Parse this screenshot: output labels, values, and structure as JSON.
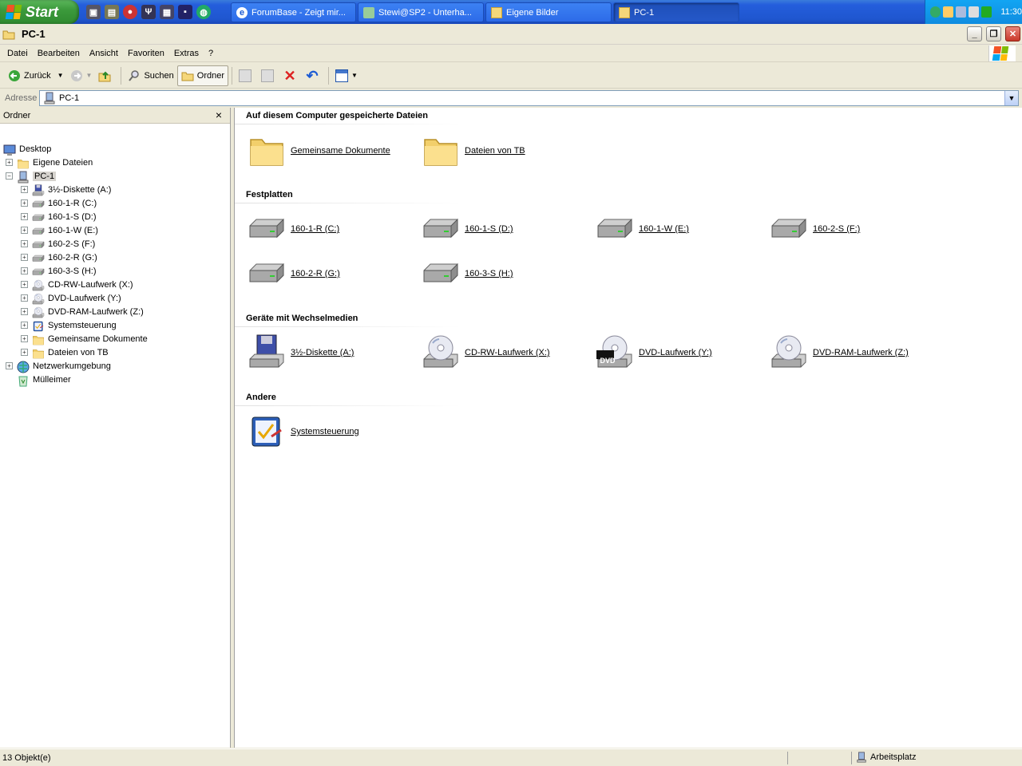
{
  "taskbar": {
    "start_label": "Start",
    "quicklaunch": [
      "app-icon",
      "app-icon",
      "app-icon",
      "app-icon",
      "app-icon",
      "save-icon",
      "globe-icon"
    ],
    "buttons": [
      {
        "label": "ForumBase - Zeigt mir..."
      },
      {
        "label": "Stewi@SP2 - Unterha..."
      },
      {
        "label": "Eigene Bilder"
      },
      {
        "label": "PC-1"
      }
    ],
    "clock": "11:30"
  },
  "window": {
    "title": "PC-1"
  },
  "menubar": {
    "items": [
      "Datei",
      "Bearbeiten",
      "Ansicht",
      "Favoriten",
      "Extras",
      "?"
    ]
  },
  "toolbar": {
    "back": "Zurück",
    "search": "Suchen",
    "folders": "Ordner"
  },
  "address": {
    "label": "Adresse",
    "value": "PC-1"
  },
  "folderpane": {
    "title": "Ordner",
    "close": "×",
    "tree": [
      {
        "label": "Desktop",
        "icon": "desktop-icon",
        "level": 0,
        "expander": ""
      },
      {
        "label": "Eigene Dateien",
        "icon": "folder-icon",
        "level": 1,
        "expander": "+"
      },
      {
        "label": "PC-1",
        "icon": "computer-icon",
        "level": 1,
        "expander": "−",
        "selected": true
      },
      {
        "label": "3½-Diskette (A:)",
        "icon": "floppy-icon",
        "level": 2,
        "expander": "+"
      },
      {
        "label": "160-1-R (C:)",
        "icon": "drive-icon",
        "level": 2,
        "expander": "+"
      },
      {
        "label": "160-1-S (D:)",
        "icon": "drive-icon",
        "level": 2,
        "expander": "+"
      },
      {
        "label": "160-1-W (E:)",
        "icon": "drive-icon",
        "level": 2,
        "expander": "+"
      },
      {
        "label": "160-2-S (F:)",
        "icon": "drive-icon",
        "level": 2,
        "expander": "+"
      },
      {
        "label": "160-2-R (G:)",
        "icon": "drive-icon",
        "level": 2,
        "expander": "+"
      },
      {
        "label": "160-3-S (H:)",
        "icon": "drive-icon",
        "level": 2,
        "expander": "+"
      },
      {
        "label": "CD-RW-Laufwerk (X:)",
        "icon": "cd-icon",
        "level": 2,
        "expander": "+"
      },
      {
        "label": "DVD-Laufwerk (Y:)",
        "icon": "cd-icon",
        "level": 2,
        "expander": "+"
      },
      {
        "label": "DVD-RAM-Laufwerk (Z:)",
        "icon": "cd-icon",
        "level": 2,
        "expander": "+"
      },
      {
        "label": "Systemsteuerung",
        "icon": "control-panel-icon",
        "level": 2,
        "expander": "+"
      },
      {
        "label": "Gemeinsame Dokumente",
        "icon": "folder-icon",
        "level": 2,
        "expander": "+"
      },
      {
        "label": "Dateien von TB",
        "icon": "folder-icon",
        "level": 2,
        "expander": "+"
      },
      {
        "label": "Netzwerkumgebung",
        "icon": "network-icon",
        "level": 1,
        "expander": "+"
      },
      {
        "label": "Mülleimer",
        "icon": "recycle-bin-icon",
        "level": 1,
        "expander": ""
      }
    ]
  },
  "content": {
    "groups": [
      {
        "title": "Auf diesem Computer gespeicherte Dateien",
        "items": [
          {
            "label": "Gemeinsame Dokumente",
            "icon": "folder-icon"
          },
          {
            "label": "Dateien von TB",
            "icon": "folder-icon"
          }
        ]
      },
      {
        "title": "Festplatten",
        "items": [
          {
            "label": "160-1-R (C:)",
            "icon": "drive-icon"
          },
          {
            "label": "160-1-S (D:)",
            "icon": "drive-icon"
          },
          {
            "label": "160-1-W (E:)",
            "icon": "drive-icon"
          },
          {
            "label": "160-2-S (F:)",
            "icon": "drive-icon"
          },
          {
            "label": "160-2-R (G:)",
            "icon": "drive-icon"
          },
          {
            "label": "160-3-S (H:)",
            "icon": "drive-icon"
          }
        ]
      },
      {
        "title": "Geräte mit Wechselmedien",
        "items": [
          {
            "label": "3½-Diskette (A:)",
            "icon": "floppy-icon"
          },
          {
            "label": "CD-RW-Laufwerk (X:)",
            "icon": "cd-icon"
          },
          {
            "label": "DVD-Laufwerk (Y:)",
            "icon": "dvd-icon",
            "badge": "DVD"
          },
          {
            "label": "DVD-RAM-Laufwerk (Z:)",
            "icon": "cd-icon"
          }
        ]
      },
      {
        "title": "Andere",
        "items": [
          {
            "label": "Systemsteuerung",
            "icon": "control-panel-icon"
          }
        ]
      }
    ]
  },
  "statusbar": {
    "objects": "13 Objekt(e)",
    "zone": "Arbeitsplatz"
  },
  "colors": {
    "taskbar": "#245edc",
    "start": "#3c9a3c",
    "tray": "#0f8ce0",
    "selection": "#d6d3ce",
    "window_bg": "#ece9d8"
  }
}
